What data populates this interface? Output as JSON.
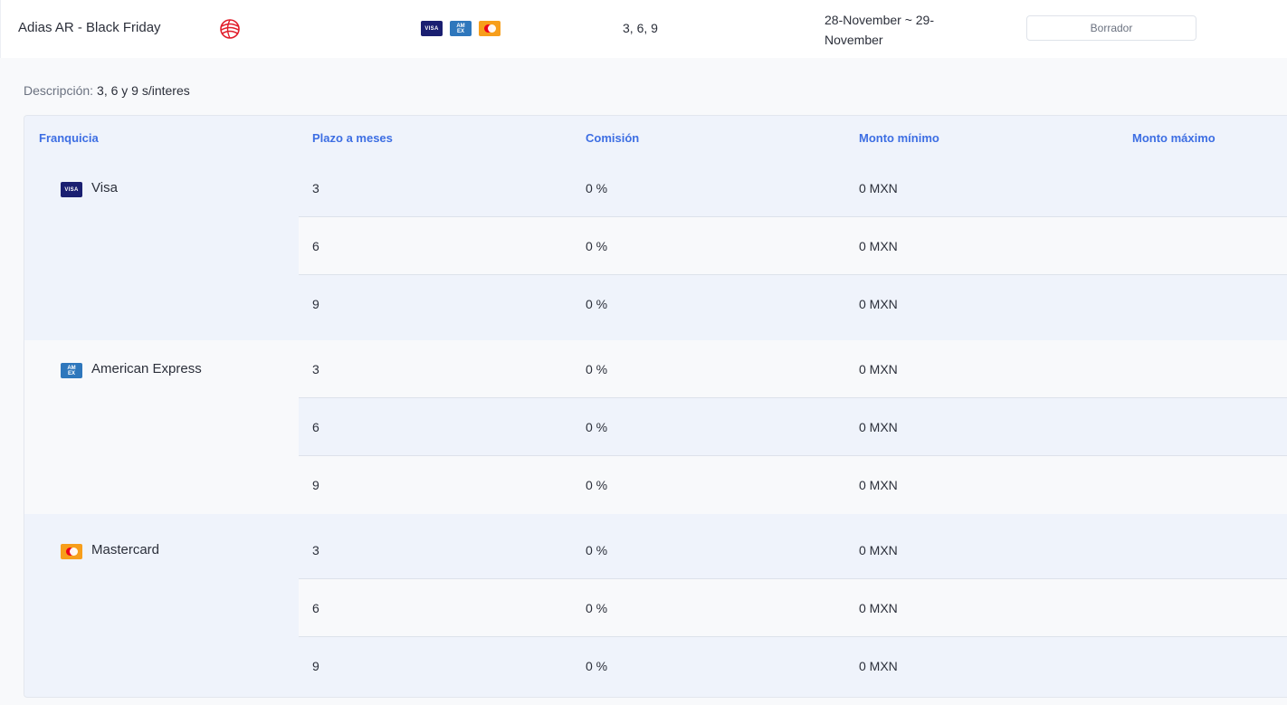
{
  "campaign": {
    "name": "Adias AR - Black Friday",
    "brand_logo_icon": "red-globe-logo-icon",
    "card_icons": [
      "visa-icon",
      "amex-icon",
      "mastercard-icon"
    ],
    "visa_text": "VISA",
    "amex_text": "AM EX",
    "plazos": "3, 6, 9",
    "dates": "28-November ~ 29-November",
    "status_label": "Borrador"
  },
  "detail": {
    "description_label": "Descripción:",
    "description_value": "3, 6 y 9 s/interes",
    "columns": [
      "Franquicia",
      "Plazo a meses",
      "Comisión",
      "Monto mínimo",
      "Monto máximo"
    ],
    "groups": [
      {
        "franchise": "Visa",
        "icon": "visa-icon",
        "rows": [
          {
            "plazo": "3",
            "comision": "0 %",
            "minimo": "0 MXN",
            "maximo": ""
          },
          {
            "plazo": "6",
            "comision": "0 %",
            "minimo": "0 MXN",
            "maximo": ""
          },
          {
            "plazo": "9",
            "comision": "0 %",
            "minimo": "0 MXN",
            "maximo": ""
          }
        ]
      },
      {
        "franchise": "American Express",
        "icon": "amex-icon",
        "rows": [
          {
            "plazo": "3",
            "comision": "0 %",
            "minimo": "0 MXN",
            "maximo": ""
          },
          {
            "plazo": "6",
            "comision": "0 %",
            "minimo": "0 MXN",
            "maximo": ""
          },
          {
            "plazo": "9",
            "comision": "0 %",
            "minimo": "0 MXN",
            "maximo": ""
          }
        ]
      },
      {
        "franchise": "Mastercard",
        "icon": "mastercard-icon",
        "rows": [
          {
            "plazo": "3",
            "comision": "0 %",
            "minimo": "0 MXN",
            "maximo": ""
          },
          {
            "plazo": "6",
            "comision": "0 %",
            "minimo": "0 MXN",
            "maximo": ""
          },
          {
            "plazo": "9",
            "comision": "0 %",
            "minimo": "0 MXN",
            "maximo": ""
          }
        ]
      }
    ]
  },
  "colors": {
    "header_text": "#3d6ee3",
    "row_light": "#f8f9fb",
    "row_tint": "#eff3fb",
    "visa": "#1a1f71",
    "amex": "#2e77bc",
    "mastercard": "#f79e1b"
  }
}
